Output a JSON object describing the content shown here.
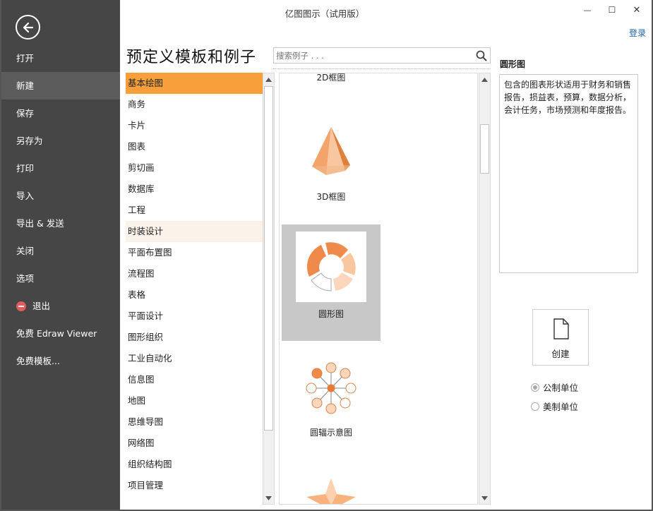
{
  "window": {
    "title": "亿图图示（试用版）",
    "login_label": "登录",
    "minimize_glyph": "—",
    "maximize_glyph": "☐",
    "close_glyph": "✕"
  },
  "sidebar": {
    "items": [
      {
        "label": "打开"
      },
      {
        "label": "新建"
      },
      {
        "label": "保存"
      },
      {
        "label": "另存为"
      },
      {
        "label": "打印"
      },
      {
        "label": "导入"
      },
      {
        "label": "导出 & 发送"
      },
      {
        "label": "关闭"
      },
      {
        "label": "选项"
      },
      {
        "label": "退出"
      },
      {
        "label": "免费 Edraw Viewer"
      },
      {
        "label": "免费模板..."
      }
    ]
  },
  "main": {
    "title": "预定义模板和例子",
    "search_placeholder": "搜索例子 . . ."
  },
  "categories": [
    "基本绘图",
    "商务",
    "卡片",
    "图表",
    "剪切画",
    "数据库",
    "工程",
    "时装设计",
    "平面布置图",
    "流程图",
    "表格",
    "平面设计",
    "图形组织",
    "工业自动化",
    "信息图",
    "地图",
    "思维导图",
    "网络图",
    "组织结构图",
    "项目管理"
  ],
  "templates": [
    {
      "label": "2D框图"
    },
    {
      "label": "3D框图"
    },
    {
      "label": "圆形图"
    },
    {
      "label": "圆辐示意图"
    }
  ],
  "description": {
    "title": "圆形图",
    "text": "包含的图表形状适用于财务和销售报告，损益表，预算，数据分析，会计任务，市场预测和年度报告。"
  },
  "actions": {
    "create_label": "创建",
    "unit_metric": "公制单位",
    "unit_us": "美制单位"
  },
  "colors": {
    "accent": "#f7a03b",
    "sidebar": "#464646",
    "link": "#1f5fa8"
  }
}
